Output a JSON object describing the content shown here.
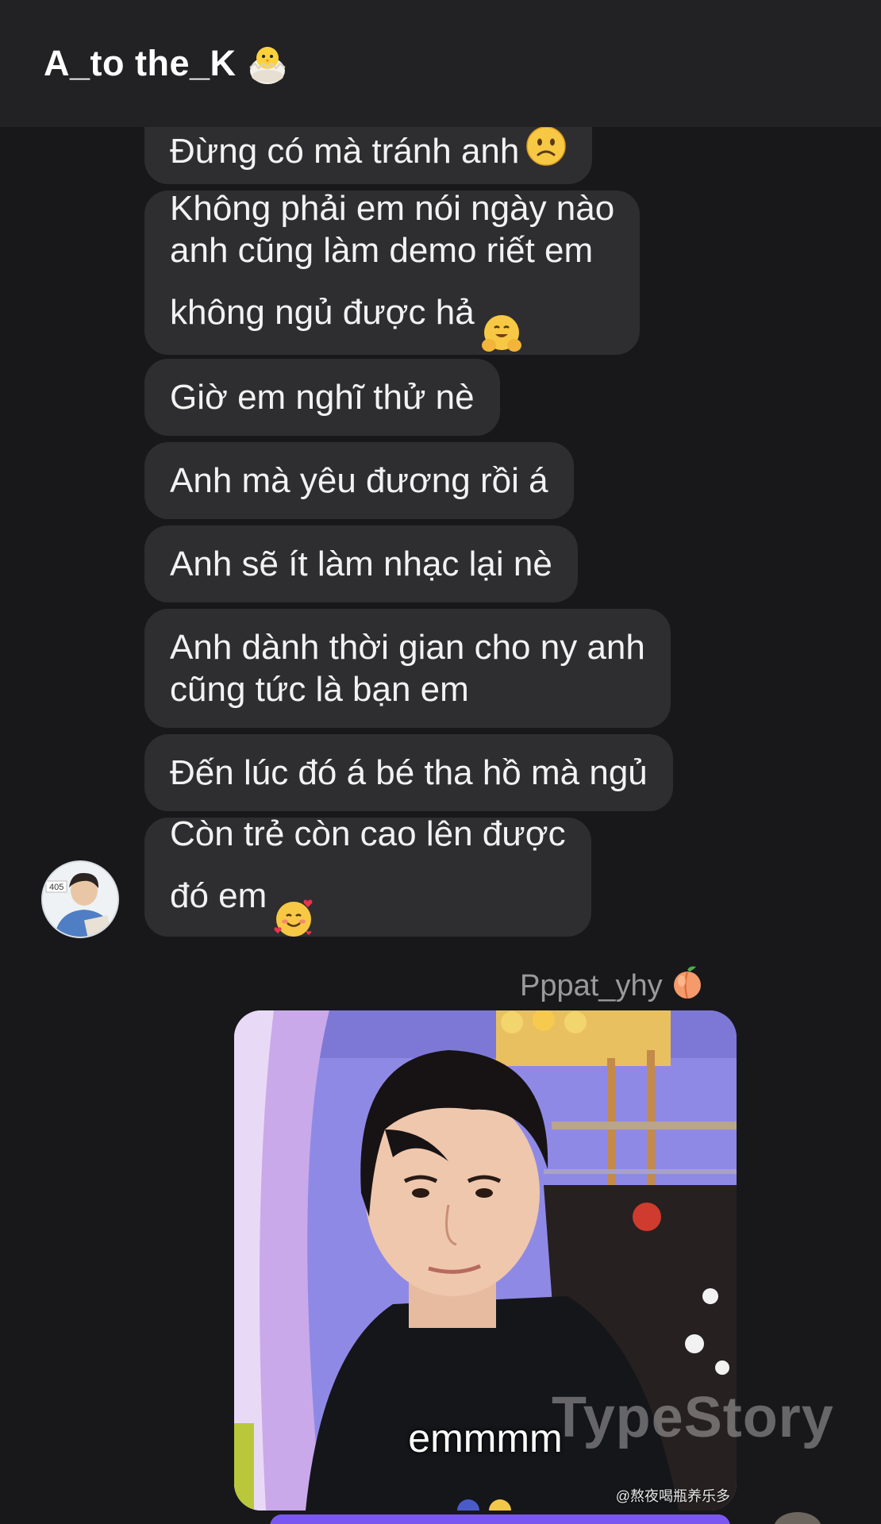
{
  "header": {
    "title": "A_to the_K",
    "emoji_icon": "hatching-chick-icon"
  },
  "messages": [
    {
      "text": "Đừng có mà tránh anh",
      "emoji": "slightly-frowning-face-icon"
    },
    {
      "text": "Không phải em nói ngày nào\nanh cũng làm demo riết em\nkhông ngủ được hả",
      "emoji": "hugging-face-icon"
    },
    {
      "text": "Giờ em nghĩ thử nè"
    },
    {
      "text": "Anh mà yêu đương rồi á"
    },
    {
      "text": "Anh sẽ ít làm nhạc lại nè"
    },
    {
      "text": "Anh dành thời gian cho ny anh\ncũng tức là bạn em"
    },
    {
      "text": "Đến lúc đó á bé tha hồ mà ngủ"
    },
    {
      "text": "Còn trẻ còn cao lên được\nđó em",
      "emoji": "smiling-face-with-hearts-icon"
    }
  ],
  "avatar": {
    "badge": "405"
  },
  "reply": {
    "sender": "Pppat_yhy",
    "sender_emoji": "peach-icon",
    "photo_caption": "emmmm",
    "photo_credit": "@熬夜喝瓶养乐多"
  },
  "watermark": "TypeStory",
  "colors": {
    "background": "#18181a",
    "header": "#222224",
    "bubble": "#2e2e30",
    "accent": "#7b57f2"
  }
}
